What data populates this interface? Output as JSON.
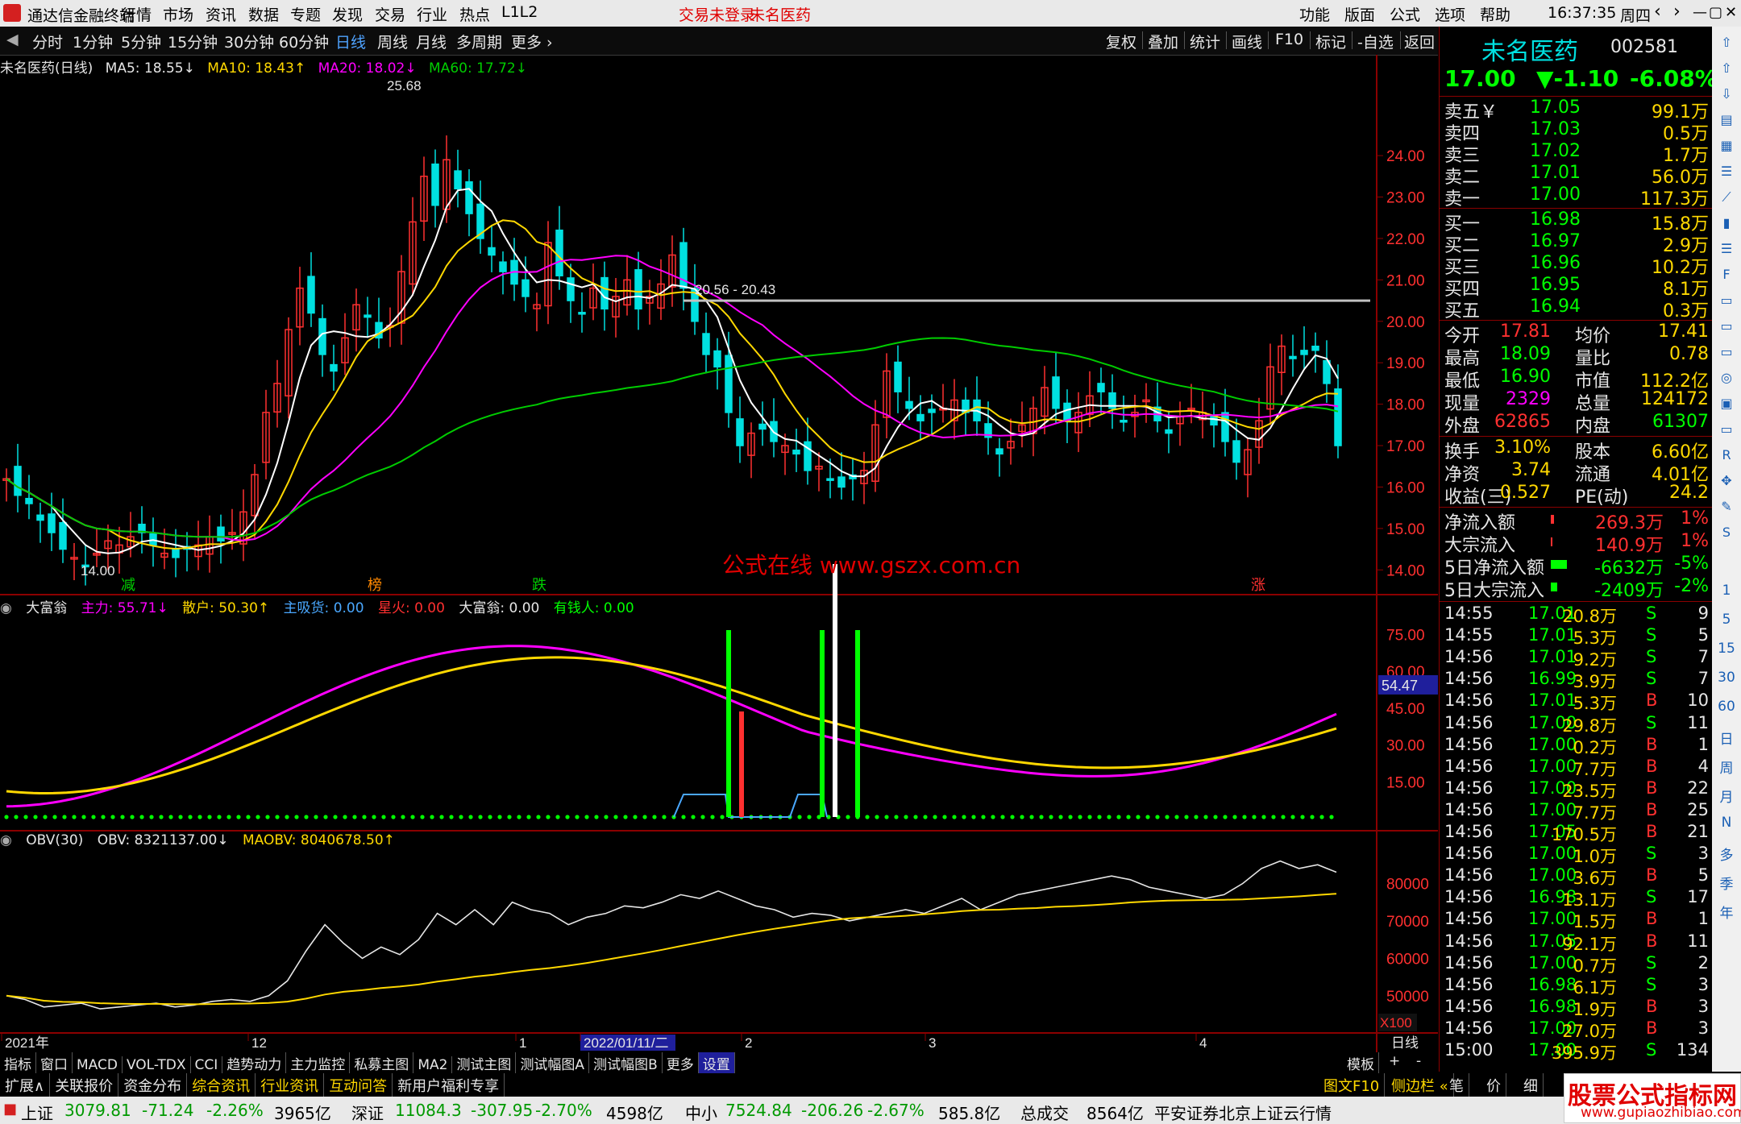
{
  "menubar": {
    "title": "通达信金融终端",
    "items": [
      "行情",
      "市场",
      "资讯",
      "数据",
      "专题",
      "发现",
      "交易",
      "行业",
      "热点",
      "L1L2"
    ],
    "notice1": "交易未登录",
    "notice2": "未名医药",
    "right_items": [
      "功能",
      "版面",
      "公式",
      "选项",
      "帮助"
    ],
    "clock": "16:37:35",
    "weekday": "周四",
    "win_buttons": [
      "‹",
      "›",
      "—",
      "▢",
      "✕"
    ]
  },
  "periodbar": {
    "periods": [
      "分时",
      "1分钟",
      "5分钟",
      "15分钟",
      "30分钟",
      "60分钟",
      "日线",
      "周线",
      "月线",
      "多周期",
      "更多 ›"
    ],
    "active": "日线",
    "right": [
      "复权",
      "叠加",
      "统计",
      "画线",
      "F10",
      "标记",
      "-自选",
      "返回"
    ]
  },
  "main_chart": {
    "stock_label": "未名医药(日线)",
    "ma5": "MA5: 18.55↓",
    "ma10": "MA10: 18.43↑",
    "ma20": "MA20: 18.02↓",
    "ma60": "MA60: 17.72↓",
    "high_label": "25.68",
    "low_label": "14.00",
    "hline_label": "20.56 - 20.43",
    "y_ticks": [
      "24.00",
      "23.00",
      "22.00",
      "21.00",
      "20.00",
      "19.00",
      "18.00",
      "17.00",
      "16.00",
      "15.00",
      "14.00"
    ],
    "markers": [
      {
        "text": "减",
        "color": "#00cc00"
      },
      {
        "text": "榜",
        "color": "#ff8800"
      },
      {
        "text": "跌",
        "color": "#00cc00"
      },
      {
        "text": "涨",
        "color": "#ff3030"
      }
    ],
    "watermark": "公式在线  www.gszx.com.cn"
  },
  "ind1": {
    "name": "大富翁",
    "zhuli": "主力: 55.71↓",
    "sanhu": "散户: 50.30↑",
    "zhuxihuo": "主吸货: 0.00",
    "xinghuo": "星火: 0.00",
    "dafuweng": "大富翁: 0.00",
    "youqianren": "有钱人: 0.00",
    "value_box": "54.47",
    "y_ticks": [
      "75.00",
      "60.00",
      "45.00",
      "30.00",
      "15.00"
    ]
  },
  "ind2": {
    "name": "OBV(30)",
    "obv": "OBV: 8321137.00↓",
    "maobv": "MAOBV: 8040678.50↑",
    "y_ticks": [
      "80000",
      "70000",
      "60000",
      "50000"
    ],
    "unit": "X100"
  },
  "xaxis": {
    "labels": [
      "2021年",
      "12",
      "1",
      "2022/01/11/二",
      "2",
      "3",
      "4"
    ],
    "period": "日线"
  },
  "bottomtabs": {
    "items": [
      "指标",
      "窗口",
      "MACD",
      "VOL-TDX",
      "CCI",
      "趋势动力",
      "主力监控",
      "私募主图",
      "MA2",
      "测试主图",
      "测试幅图A",
      "测试幅图B",
      "更多",
      "设置"
    ],
    "active": "设置",
    "right": [
      "模板",
      "+",
      "-"
    ]
  },
  "tabs2": {
    "items": [
      "扩展∧",
      "关联报价",
      "资金分布",
      "综合资讯",
      "行业资讯",
      "互动问答",
      "新用户福利专享"
    ],
    "highlight": [
      "综合资讯",
      "行业资讯",
      "互动问答"
    ],
    "right": [
      "图文F10",
      "侧边栏 «",
      "笔",
      "价",
      "细"
    ]
  },
  "statusbar": {
    "sh_name": "上证",
    "sh_val": "3079.81",
    "sh_chg": "-71.24",
    "sh_pct": "-2.26%",
    "sh_amt": "3965亿",
    "sz_name": "深证",
    "sz_val": "11084.3",
    "sz_chg": "-307.95",
    "sz_pct": "-2.70%",
    "sz_amt": "4598亿",
    "zx_name": "中小",
    "zx_val": "7524.84",
    "zx_chg": "-206.26",
    "zx_pct": "-2.67%",
    "zx_amt": "585.8亿",
    "total_label": "总成交",
    "total_val": "8564亿",
    "broker": "平安证券北京上证云行情"
  },
  "rpanel": {
    "name": "未名医药",
    "code": "002581",
    "price": "17.00",
    "change": "▼-1.10",
    "pct": "-6.08%",
    "asks": [
      {
        "l": "卖五￥",
        "v": "17.05",
        "s": "99.1万"
      },
      {
        "l": "卖四",
        "v": "17.03",
        "s": "0.5万"
      },
      {
        "l": "卖三",
        "v": "17.02",
        "s": "1.7万"
      },
      {
        "l": "卖二",
        "v": "17.01",
        "s": "56.0万"
      },
      {
        "l": "卖一",
        "v": "17.00",
        "s": "117.3万"
      }
    ],
    "bids": [
      {
        "l": "买一",
        "v": "16.98",
        "s": "15.8万"
      },
      {
        "l": "买二",
        "v": "16.97",
        "s": "2.9万"
      },
      {
        "l": "买三",
        "v": "16.96",
        "s": "10.2万"
      },
      {
        "l": "买四",
        "v": "16.95",
        "s": "8.1万"
      },
      {
        "l": "买五",
        "v": "16.94",
        "s": "0.3万"
      }
    ],
    "stats": [
      {
        "l1": "今开",
        "v1": "17.81",
        "c1": "#ff3030",
        "l2": "均价",
        "v2": "17.41",
        "c2": "#ffd800"
      },
      {
        "l1": "最高",
        "v1": "18.09",
        "c1": "#00ff00",
        "l2": "量比",
        "v2": "0.78",
        "c2": "#ffd800"
      },
      {
        "l1": "最低",
        "v1": "16.90",
        "c1": "#00ff00",
        "l2": "市值",
        "v2": "112.2亿",
        "c2": "#ffd800"
      },
      {
        "l1": "现量",
        "v1": "2329",
        "c1": "#ff00ff",
        "l2": "总量",
        "v2": "124172",
        "c2": "#ffd800"
      },
      {
        "l1": "外盘",
        "v1": "62865",
        "c1": "#ff3030",
        "l2": "内盘",
        "v2": "61307",
        "c2": "#00ff00"
      }
    ],
    "stats2": [
      {
        "l1": "换手",
        "v1": "3.10%",
        "c1": "#ffd800",
        "l2": "股本",
        "v2": "6.60亿",
        "c2": "#ffd800"
      },
      {
        "l1": "净资",
        "v1": "3.74",
        "c1": "#ffd800",
        "l2": "流通",
        "v2": "4.01亿",
        "c2": "#ffd800"
      },
      {
        "l1": "收益(三)",
        "v1": "0.527",
        "c1": "#ffd800",
        "l2": "PE(动)",
        "v2": "24.2",
        "c2": "#ffd800"
      }
    ],
    "flows": [
      {
        "l": "净流入额",
        "v": "269.3万",
        "p": "1%",
        "c": "#ff3030",
        "bar": 4
      },
      {
        "l": "大宗流入",
        "v": "140.9万",
        "p": "1%",
        "c": "#ff3030",
        "bar": 2
      },
      {
        "l": "5日净流入额",
        "v": "-6632万",
        "p": "-5%",
        "c": "#00ff00",
        "bar": 20
      },
      {
        "l": "5日大宗流入",
        "v": "-2409万",
        "p": "-2%",
        "c": "#00ff00",
        "bar": 8
      }
    ],
    "ticks": [
      {
        "t": "14:55",
        "p": "17.01",
        "v": "20.8万",
        "bs": "S",
        "n": "9"
      },
      {
        "t": "14:55",
        "p": "17.01",
        "v": "5.3万",
        "bs": "S",
        "n": "5"
      },
      {
        "t": "14:56",
        "p": "17.01",
        "v": "9.2万",
        "bs": "S",
        "n": "7"
      },
      {
        "t": "14:56",
        "p": "16.99",
        "v": "3.9万",
        "bs": "S",
        "n": "7"
      },
      {
        "t": "14:56",
        "p": "17.01",
        "v": "5.3万",
        "bs": "B",
        "n": "10"
      },
      {
        "t": "14:56",
        "p": "17.00",
        "v": "29.8万",
        "bs": "S",
        "n": "11"
      },
      {
        "t": "14:56",
        "p": "17.00",
        "v": "0.2万",
        "bs": "B",
        "n": "1"
      },
      {
        "t": "14:56",
        "p": "17.00",
        "v": "7.7万",
        "bs": "B",
        "n": "4"
      },
      {
        "t": "14:56",
        "p": "17.00",
        "v": "23.5万",
        "bs": "B",
        "n": "22"
      },
      {
        "t": "14:56",
        "p": "17.00",
        "v": "7.7万",
        "bs": "B",
        "n": "25"
      },
      {
        "t": "14:56",
        "p": "17.05",
        "v": "170.5万",
        "bs": "B",
        "n": "21"
      },
      {
        "t": "14:56",
        "p": "17.00",
        "v": "1.0万",
        "bs": "S",
        "n": "3"
      },
      {
        "t": "14:56",
        "p": "17.00",
        "v": "3.6万",
        "bs": "B",
        "n": "5"
      },
      {
        "t": "14:56",
        "p": "16.98",
        "v": "13.1万",
        "bs": "S",
        "n": "17"
      },
      {
        "t": "14:56",
        "p": "17.00",
        "v": "1.5万",
        "bs": "B",
        "n": "1"
      },
      {
        "t": "14:56",
        "p": "17.05",
        "v": "92.1万",
        "bs": "B",
        "n": "11"
      },
      {
        "t": "14:56",
        "p": "17.00",
        "v": "0.7万",
        "bs": "S",
        "n": "2"
      },
      {
        "t": "14:56",
        "p": "16.98",
        "v": "6.1万",
        "bs": "S",
        "n": "3"
      },
      {
        "t": "14:56",
        "p": "16.98",
        "v": "1.9万",
        "bs": "B",
        "n": "3"
      },
      {
        "t": "14:56",
        "p": "17.00",
        "v": "27.0万",
        "bs": "B",
        "n": "3"
      },
      {
        "t": "15:00",
        "p": "17.00",
        "v": "395.9万",
        "bs": "S",
        "n": "134"
      }
    ]
  },
  "toolstrip": {
    "icons": [
      "arrow-up",
      "arrow-up",
      "arrow-down",
      "book",
      "grid",
      "list",
      "chart",
      "candle",
      "list",
      "f10",
      "page",
      "page",
      "page",
      "circle",
      "calc",
      "page",
      "rsi",
      "move",
      "pen",
      "fs"
    ],
    "labels": [
      "1",
      "5",
      "15",
      "30",
      "60",
      "日",
      "周",
      "月",
      "N",
      "多",
      "季",
      "年"
    ]
  },
  "brand_logo": {
    "text": "股票公式指标网",
    "sub": "www.gupiaozhibiao.com"
  },
  "colors": {
    "up": "#ff3030",
    "down": "#00ff00",
    "ma5": "#ffffff",
    "ma10": "#ffd800",
    "ma20": "#ff00ff",
    "ma60": "#00cc00",
    "grid": "#8b0000"
  }
}
